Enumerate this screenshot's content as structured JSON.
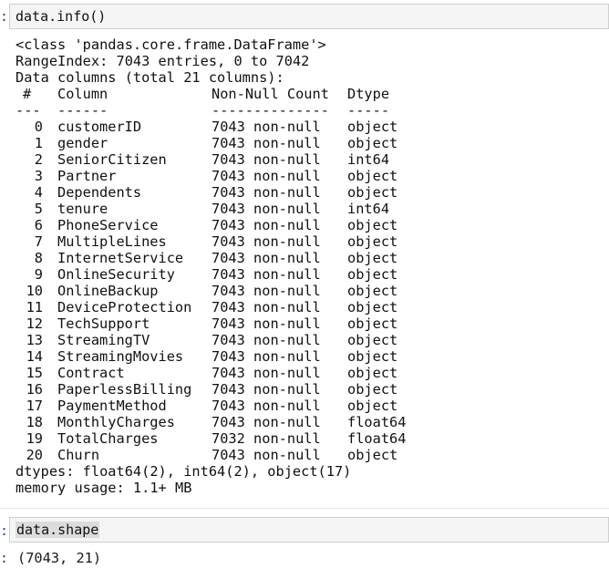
{
  "cell1": {
    "prompt": ":",
    "code": "data.info()"
  },
  "info": {
    "class_line": "<class 'pandas.core.frame.DataFrame'>",
    "range_index": "RangeIndex: 7043 entries, 0 to 7042",
    "data_columns": "Data columns (total 21 columns):",
    "header": {
      "num": "#",
      "column": "Column",
      "non_null": "Non-Null Count",
      "dtype": "Dtype"
    },
    "underline": {
      "num": "---",
      "column": "------",
      "non_null": "--------------",
      "dtype": "-----"
    },
    "rows": [
      {
        "num": "0",
        "column": "customerID",
        "non_null": "7043 non-null",
        "dtype": "object"
      },
      {
        "num": "1",
        "column": "gender",
        "non_null": "7043 non-null",
        "dtype": "object"
      },
      {
        "num": "2",
        "column": "SeniorCitizen",
        "non_null": "7043 non-null",
        "dtype": "int64"
      },
      {
        "num": "3",
        "column": "Partner",
        "non_null": "7043 non-null",
        "dtype": "object"
      },
      {
        "num": "4",
        "column": "Dependents",
        "non_null": "7043 non-null",
        "dtype": "object"
      },
      {
        "num": "5",
        "column": "tenure",
        "non_null": "7043 non-null",
        "dtype": "int64"
      },
      {
        "num": "6",
        "column": "PhoneService",
        "non_null": "7043 non-null",
        "dtype": "object"
      },
      {
        "num": "7",
        "column": "MultipleLines",
        "non_null": "7043 non-null",
        "dtype": "object"
      },
      {
        "num": "8",
        "column": "InternetService",
        "non_null": "7043 non-null",
        "dtype": "object"
      },
      {
        "num": "9",
        "column": "OnlineSecurity",
        "non_null": "7043 non-null",
        "dtype": "object"
      },
      {
        "num": "10",
        "column": "OnlineBackup",
        "non_null": "7043 non-null",
        "dtype": "object"
      },
      {
        "num": "11",
        "column": "DeviceProtection",
        "non_null": "7043 non-null",
        "dtype": "object"
      },
      {
        "num": "12",
        "column": "TechSupport",
        "non_null": "7043 non-null",
        "dtype": "object"
      },
      {
        "num": "13",
        "column": "StreamingTV",
        "non_null": "7043 non-null",
        "dtype": "object"
      },
      {
        "num": "14",
        "column": "StreamingMovies",
        "non_null": "7043 non-null",
        "dtype": "object"
      },
      {
        "num": "15",
        "column": "Contract",
        "non_null": "7043 non-null",
        "dtype": "object"
      },
      {
        "num": "16",
        "column": "PaperlessBilling",
        "non_null": "7043 non-null",
        "dtype": "object"
      },
      {
        "num": "17",
        "column": "PaymentMethod",
        "non_null": "7043 non-null",
        "dtype": "object"
      },
      {
        "num": "18",
        "column": "MonthlyCharges",
        "non_null": "7043 non-null",
        "dtype": "float64"
      },
      {
        "num": "19",
        "column": "TotalCharges",
        "non_null": "7032 non-null",
        "dtype": "float64"
      },
      {
        "num": "20",
        "column": "Churn",
        "non_null": "7043 non-null",
        "dtype": "object"
      }
    ],
    "dtypes_line": "dtypes: float64(2), int64(2), object(17)",
    "memory_line": "memory usage: 1.1+ MB"
  },
  "cell2": {
    "prompt": ":",
    "code": "data.shape",
    "out_prompt": ":",
    "output": "(7043, 21)"
  }
}
